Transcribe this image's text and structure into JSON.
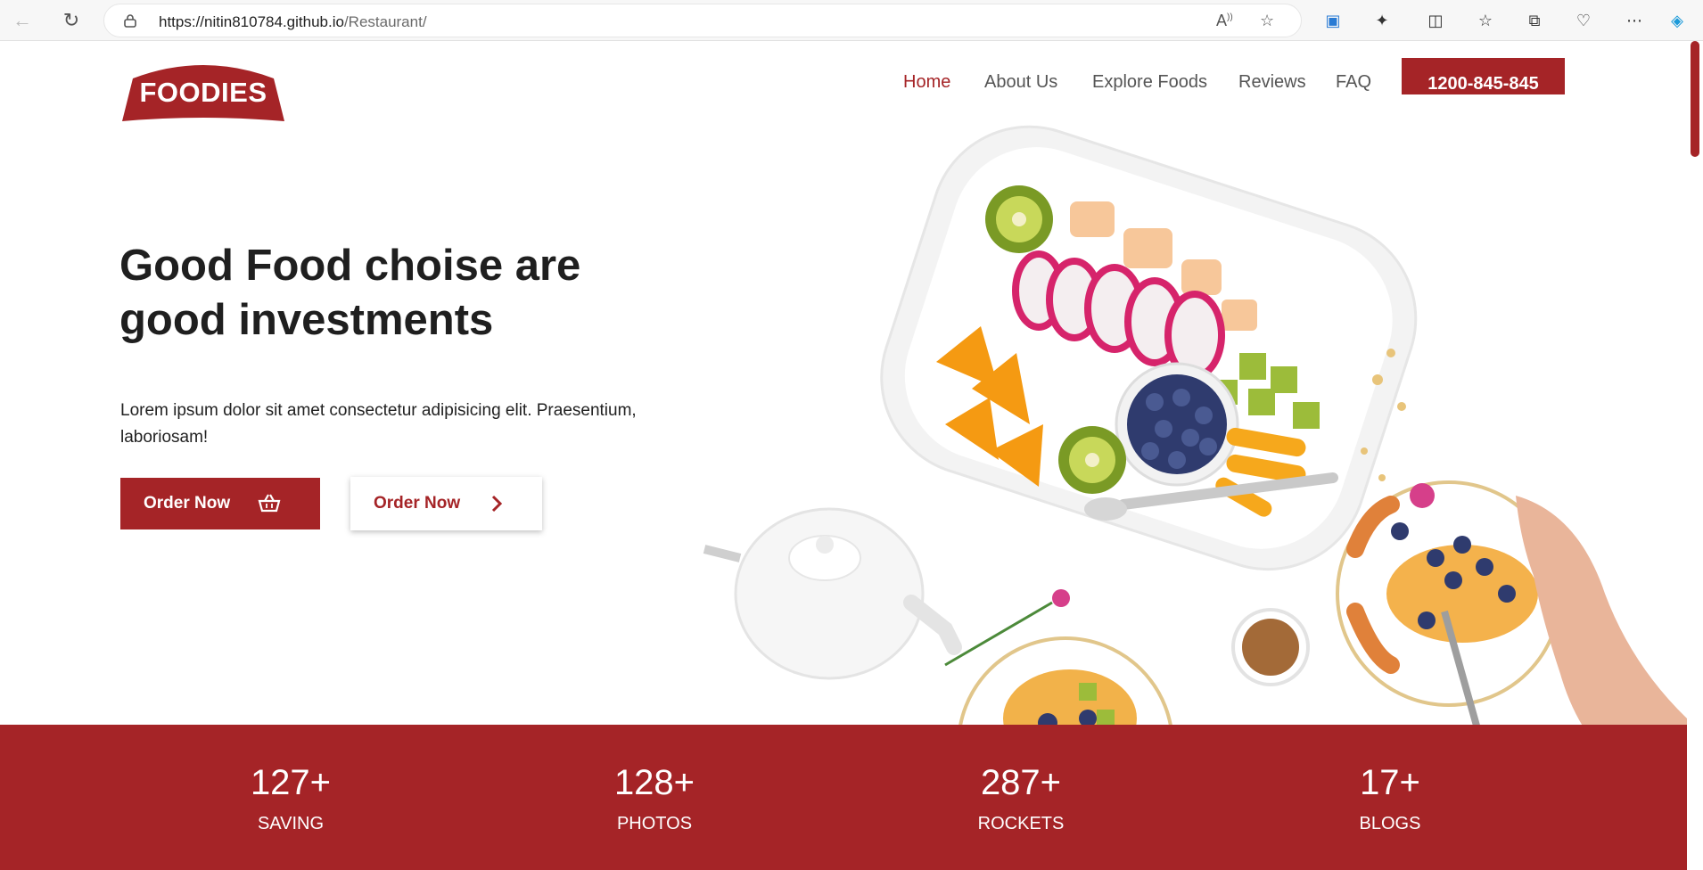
{
  "browser": {
    "url_host": "https://nitin810784.github.io",
    "url_path": "/Restaurant/",
    "read_aloud_icon": "read-aloud-icon",
    "favorite_icon": "star-icon"
  },
  "brand": {
    "logo_text": "FOODIES",
    "accent": "#a52427"
  },
  "nav": {
    "items": [
      {
        "label": "Home",
        "active": true
      },
      {
        "label": "About Us",
        "active": false
      },
      {
        "label": "Explore Foods",
        "active": false
      },
      {
        "label": "Reviews",
        "active": false
      },
      {
        "label": "FAQ",
        "active": false
      }
    ],
    "phone": "1200-845-845"
  },
  "hero": {
    "title_line1": "Good Food choise are",
    "title_line2": "good investments",
    "text_line1": "Lorem ipsum dolor sit amet consectetur adipisicing elit. Praesentium,",
    "text_line2": "laboriosam!",
    "btn_primary": "Order Now",
    "btn_secondary": "Order Now"
  },
  "stats": [
    {
      "value": "127+",
      "label": "SAVING"
    },
    {
      "value": "128+",
      "label": "PHOTOS"
    },
    {
      "value": "287+",
      "label": "ROCKETS"
    },
    {
      "value": "17+",
      "label": "BLOGS"
    }
  ]
}
